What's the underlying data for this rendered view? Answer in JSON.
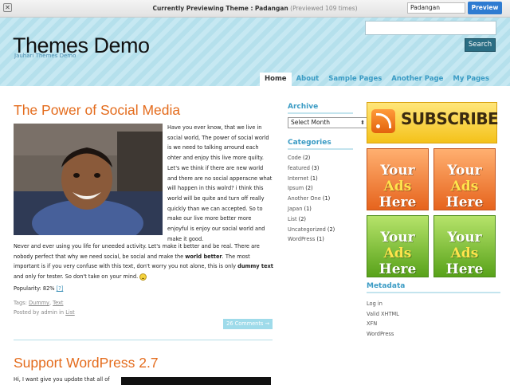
{
  "preview_bar": {
    "close_glyph": "✕",
    "prefix": "Currently Previewing Theme :",
    "theme_name": "Padangan",
    "count_text": "(Previewed 109 times)",
    "select_value": "Padangan",
    "button_label": "Preview"
  },
  "header": {
    "site_title": "Themes Demo",
    "tagline": "Jauhari Themes Demo",
    "search_button": "Search",
    "nav": [
      "Home",
      "About",
      "Sample Pages",
      "Another Page",
      "My Pages"
    ]
  },
  "post1": {
    "title": "The Power of Social Media",
    "right_text": "Have you ever know, that we live in social world, The power of social world is we need to talking arround each ohter and enjoy this live more quilty. Let's we think if there are new world and there are no social apperacne what will happen in this wolrd? i think this world will be quite and turn off really quickly than we can accepted. So to make our live more better more enjoyful is enjoy our social world and make it good.",
    "bottom_text_1": "Never and ever using you life for uneeded activity. Let's make it better and be real. There are nobody perfect that why we need social, be social and make the",
    "bottom_bold_1": "world better",
    "bottom_text_2": ". The most important is if you very confuse with this text, don't worry you not alone, this is only",
    "bottom_bold_2": "dummy text",
    "bottom_text_3": "and only for tester. So don't take on your mind.",
    "popularity_label": "Popularity: 82%",
    "popularity_help": "[?]",
    "tags_label": "Tags:",
    "tags": [
      "Dummy",
      "Text"
    ],
    "posted_prefix": "Posted by admin in",
    "category": "List",
    "comments": "26 Comments →"
  },
  "post2": {
    "title": "Support WordPress 2.7",
    "text": "Hi, I want give you update that all of"
  },
  "sidebar1": {
    "archive_title": "Archive",
    "archive_select": "Select Month",
    "categories_title": "Categories",
    "categories": [
      {
        "name": "Code",
        "count": "(2)"
      },
      {
        "name": "featured",
        "count": "(3)"
      },
      {
        "name": "Internet",
        "count": "(1)"
      },
      {
        "name": "Ipsum",
        "count": "(2)"
      },
      {
        "name": "Another One",
        "count": "(1)"
      },
      {
        "name": "Japan",
        "count": "(1)"
      },
      {
        "name": "List",
        "count": "(2)"
      },
      {
        "name": "Uncategorized",
        "count": "(2)"
      },
      {
        "name": "WordPress",
        "count": "(1)"
      }
    ]
  },
  "sidebar2": {
    "subscribe_label": "SUBSCRIBE",
    "ad_line1": "Your",
    "ad_line2a": "Ads",
    "ad_line2b": "Here",
    "metadata_title": "Metadata",
    "meta": [
      "Log in",
      "Valid XHTML",
      "XFN",
      "WordPress"
    ]
  },
  "colors": {
    "accent": "#e46c1d",
    "link": "#3a9bc4",
    "header_stripe": "#c6e8f2"
  }
}
